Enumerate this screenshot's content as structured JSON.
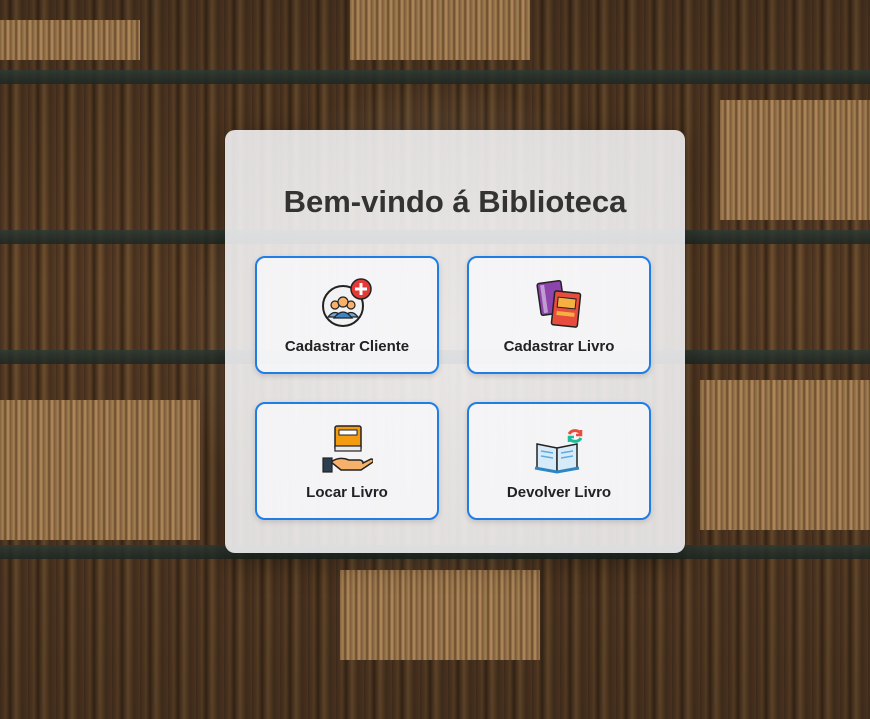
{
  "page": {
    "title": "Bem-vindo á Biblioteca"
  },
  "menu": {
    "items": [
      {
        "label": "Cadastrar Cliente",
        "icon": "add-client-icon"
      },
      {
        "label": "Cadastrar Livro",
        "icon": "books-icon"
      },
      {
        "label": "Locar Livro",
        "icon": "lend-book-icon"
      },
      {
        "label": "Devolver Livro",
        "icon": "return-book-icon"
      }
    ]
  },
  "colors": {
    "accent": "#1e7ee6",
    "title_text": "#333333",
    "card_background": "#f5f5f7"
  }
}
